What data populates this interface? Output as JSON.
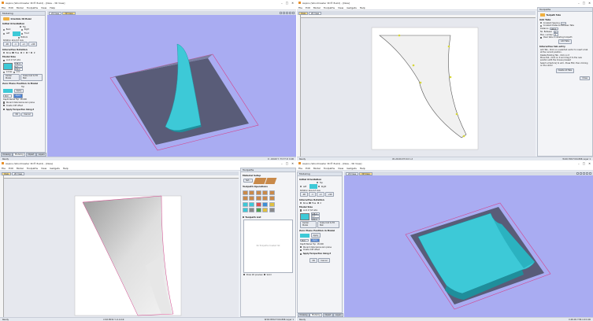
{
  "q1": {
    "title": "Aspire (Woodmaster 3D® Build) - [New - 3D View]",
    "menu": [
      "File",
      "Edit",
      "Model",
      "Toolpaths",
      "View",
      "Help"
    ],
    "panel_title": "Modeling",
    "panel_heading": "Orientate 3D Model",
    "initial_orientation": "Initial Orientation",
    "orient_options": [
      "Top",
      "Back",
      "Left",
      "Front",
      "Right",
      "Bottom"
    ],
    "rotation_label": "Rotation about Z Axis",
    "interactive_rotation": "Interactive Rotation",
    "rot_options": [
      "None",
      "Free",
      "X",
      "Y",
      "Z"
    ],
    "model_size": "Model Size",
    "lock_label": "Lock X:Y:Z ratio",
    "size_x": "136.4",
    "size_y": "3.7",
    "size_z": "200.0",
    "units": [
      "inches",
      "mm"
    ],
    "center_model": "Center Model",
    "scale_units": "Scale Unit to Fit Mat",
    "zero_plane": "Zero Plane Position in Model",
    "zero_opts": [
      "Top",
      "Bottom"
    ],
    "depth_value": "18.0",
    "apply_btn": "Apply",
    "depth_below": "Depth Below Top",
    "depth_below_val": "18.000",
    "discard_label": "Discard data below zero plane",
    "create_label": "Create drift offset",
    "perspective": "Apply Perspective Along Z",
    "ok": "OK",
    "cancel": "Cancel",
    "tabs": [
      "Drawing",
      "Modeling",
      "Clipart",
      "Layers"
    ],
    "view_tabs": [
      "2D View",
      "3D View"
    ],
    "status_left": "Ready",
    "status_right": "X: -69.60 Y: 73.77 Z: 0.00"
  },
  "q2": {
    "title": "Aspire (Woodmaster 3D® Build) - [New]",
    "menu": [
      "File",
      "Edit",
      "Model",
      "Toolpaths",
      "View",
      "Gadgets",
      "Help"
    ],
    "view_tabs": [
      "View",
      "2D View"
    ],
    "panel_title": "Toolpaths",
    "panel_heading": "Toolpath Tabs",
    "add_tabs": "Add Tabs",
    "constant_spacing": "Constant Spacing",
    "constant_between": "Constant Distance Between Tabs",
    "distance_label": "Distance",
    "distance_val": "100.0",
    "num_label": "No. Between",
    "num_val": "2",
    "max_label": "Max. number",
    "max_val": "4",
    "clear_label": "Clear tabs on existing toolpath",
    "add_btn": "Add Tabs",
    "interactive": "Interactive tab entry",
    "help1": "Add Tab - Click on a selected vector to insert a tab at the current position.",
    "help2": "Delete Existing Tab - Click on it",
    "help3": "Move Tab - Click on it and drag it to the new position with the mouse pressed",
    "help4": "Select a [Vectors] to add - Press ESC, then clicking on the vector",
    "delete_btn": "Delete All Tabs",
    "close_btn": "Close",
    "status_left": "Ready",
    "status_mid": "W:-20.019  H:0.0 1.2",
    "status_right": "W:20.766  H:64.896 Layer 1"
  },
  "q3": {
    "title": "Aspire (Woodmaster 3D® Build) - [New]",
    "menu": [
      "File",
      "Edit",
      "Model",
      "Toolpaths",
      "View",
      "Gadgets",
      "Help"
    ],
    "view_tabs": [
      "View",
      "2D View"
    ],
    "panel_title": "Toolpaths",
    "material_setup": "Material Setup",
    "set_btn": "Set...",
    "ops_title": "Toolpath Operations",
    "list_title": "Toolpath List",
    "no_toolpaths": "No Toolpaths Created Yet",
    "show_preview": "Show 2D preview",
    "solid_label": "Solid",
    "status_left": "Ready",
    "status_mid": "X:63.8532 Y:-0.1119",
    "status_right": "W:63.8532  H:64.896 Layer 1"
  },
  "q4": {
    "title": "Aspire (Woodmaster 3D® Build) - [New - 3D View]",
    "menu": [
      "File",
      "Edit",
      "Model",
      "Toolpaths",
      "View",
      "Gadgets",
      "Help"
    ],
    "view_tabs": [
      "2D View",
      "3D View"
    ],
    "panel_title": "Modeling",
    "tabs": [
      "Drawing",
      "Modeling",
      "Clipart",
      "Layers"
    ],
    "ok": "OK",
    "cancel": "Cancel",
    "status_left": "Ready",
    "status_right": "X:48.09 Y:58.4 Z:0.00"
  },
  "colors": {
    "view3d_bg": "#a9acf2",
    "material": "#595c78",
    "model": "#3dc9d7",
    "outline": "#d4438b"
  }
}
